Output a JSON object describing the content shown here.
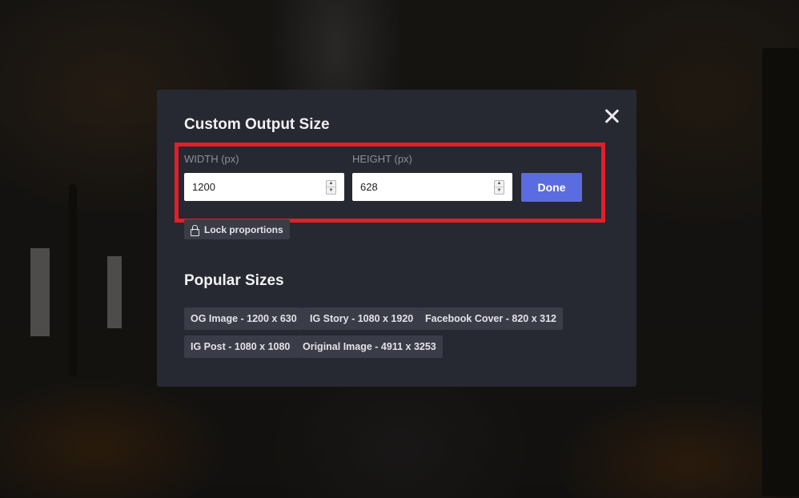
{
  "dialog": {
    "title": "Custom Output Size",
    "width_label": "WIDTH (px)",
    "width_value": "1200",
    "height_label": "HEIGHT (px)",
    "height_value": "628",
    "done_label": "Done",
    "lock_label": "Lock proportions",
    "popular_title": "Popular Sizes",
    "sizes": [
      "OG Image - 1200 x 630",
      "IG Story - 1080 x 1920",
      "Facebook Cover - 820 x 312",
      "IG Post - 1080 x 1080",
      "Original Image - 4911 x 3253"
    ]
  },
  "colors": {
    "accent": "#5b6be0",
    "highlight": "#e11f2a",
    "modal_bg": "#262832"
  },
  "icons": [
    "close-icon",
    "lock-icon",
    "stepper-up-icon",
    "stepper-down-icon"
  ]
}
